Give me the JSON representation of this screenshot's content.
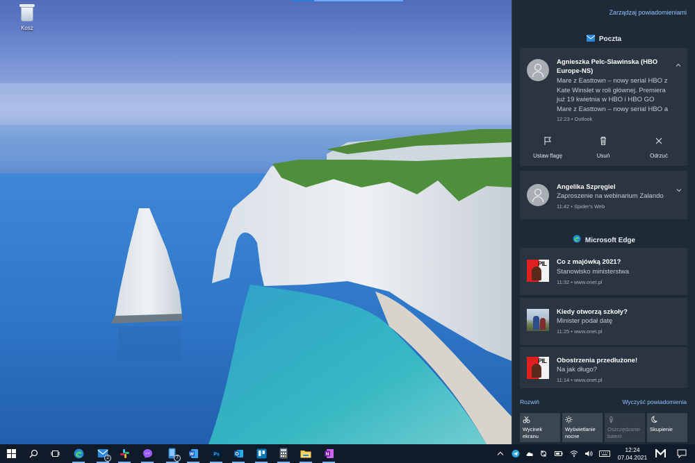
{
  "desktop": {
    "recycle_bin_label": "Kosz"
  },
  "action_center": {
    "manage_notifications": "Zarządzaj powiadomieniami",
    "groups": [
      {
        "app_name": "Poczta",
        "icon": "mail-icon",
        "notifications": [
          {
            "title_line1": "Agnieszka Pelc-Slawinska (HBO",
            "title_line2": "Europe-NS)",
            "body_lines": [
              "Mare z Easttown – nowy serial HBO z",
              "Kate Winslet w roli głównej. Premiera",
              "już 19 kwietnia w HBO i HBO GO",
              "Mare z Easttown – nowy serial HBO a"
            ],
            "meta": "12:23 • Outlook",
            "expanded": true,
            "actions": [
              {
                "label": "Ustaw flagę",
                "icon": "flag-icon"
              },
              {
                "label": "Usuń",
                "icon": "trash-icon"
              },
              {
                "label": "Odrzuć",
                "icon": "close-icon"
              }
            ]
          },
          {
            "title": "Angelika Szpręgiel",
            "body": "Zaproszenie na webinarium Zalando",
            "meta": "11:42 • Spider's Web",
            "expanded": false
          }
        ]
      },
      {
        "app_name": "Microsoft Edge",
        "icon": "edge-icon",
        "notifications": [
          {
            "title": "Co z majówką 2021?",
            "body": "Stanowisko ministerstwa",
            "meta": "11:32 • www.onet.pl",
            "thumb": "pilne"
          },
          {
            "title": "Kiedy otworzą szkoły?",
            "body": "Minister podał datę",
            "meta": "11:25 • www.onet.pl",
            "thumb": "photo"
          },
          {
            "title": "Obostrzenia przedłużone!",
            "body": "Na jak długo?",
            "meta": "11:14 • www.onet.pl",
            "thumb": "pilne"
          }
        ]
      }
    ],
    "expand_label": "Rozwiń",
    "clear_label": "Wyczyść powiadomienia",
    "quick_actions": [
      {
        "line1": "Wycinek",
        "line2": "ekranu",
        "icon": "snip-icon",
        "enabled": true
      },
      {
        "line1": "Wyświetlanie",
        "line2": "nocne",
        "icon": "brightness-icon",
        "enabled": true
      },
      {
        "line1": "Oszczędzanie",
        "line2": "baterii",
        "icon": "battery-saver-icon",
        "enabled": false
      },
      {
        "line1": "Skupienie",
        "line2": "",
        "icon": "moon-icon",
        "enabled": true
      }
    ]
  },
  "taskbar": {
    "apps": [
      {
        "name": "start",
        "icon": "windows-start-icon"
      },
      {
        "name": "search",
        "icon": "search-icon"
      },
      {
        "name": "task-view",
        "icon": "task-view-icon"
      },
      {
        "name": "edge",
        "icon": "edge-icon",
        "running": true
      },
      {
        "name": "mail",
        "icon": "mail-icon",
        "running": true,
        "badge": "2"
      },
      {
        "name": "slack",
        "icon": "slack-icon",
        "running": true
      },
      {
        "name": "messenger",
        "icon": "messenger-icon",
        "running": true
      },
      {
        "name": "phone",
        "icon": "phone-icon",
        "running": true,
        "badge": "7"
      },
      {
        "name": "word",
        "icon": "word-icon",
        "running": true
      },
      {
        "name": "photoshop",
        "icon": "photoshop-icon",
        "running": true
      },
      {
        "name": "outlook",
        "icon": "outlook-icon",
        "running": true
      },
      {
        "name": "trello",
        "icon": "trello-icon",
        "running": true
      },
      {
        "name": "calculator",
        "icon": "calculator-icon",
        "running": true
      },
      {
        "name": "explorer",
        "icon": "file-explorer-icon",
        "running": true
      },
      {
        "name": "onenote",
        "icon": "onenote-icon",
        "running": true
      }
    ],
    "time": "12:24",
    "date": "07.04.2021"
  },
  "colors": {
    "accent": "#8fc4ff",
    "panel_bg": "#1f2a37",
    "card_bg": "#2b3542",
    "taskbar_bg": "#101b29"
  }
}
